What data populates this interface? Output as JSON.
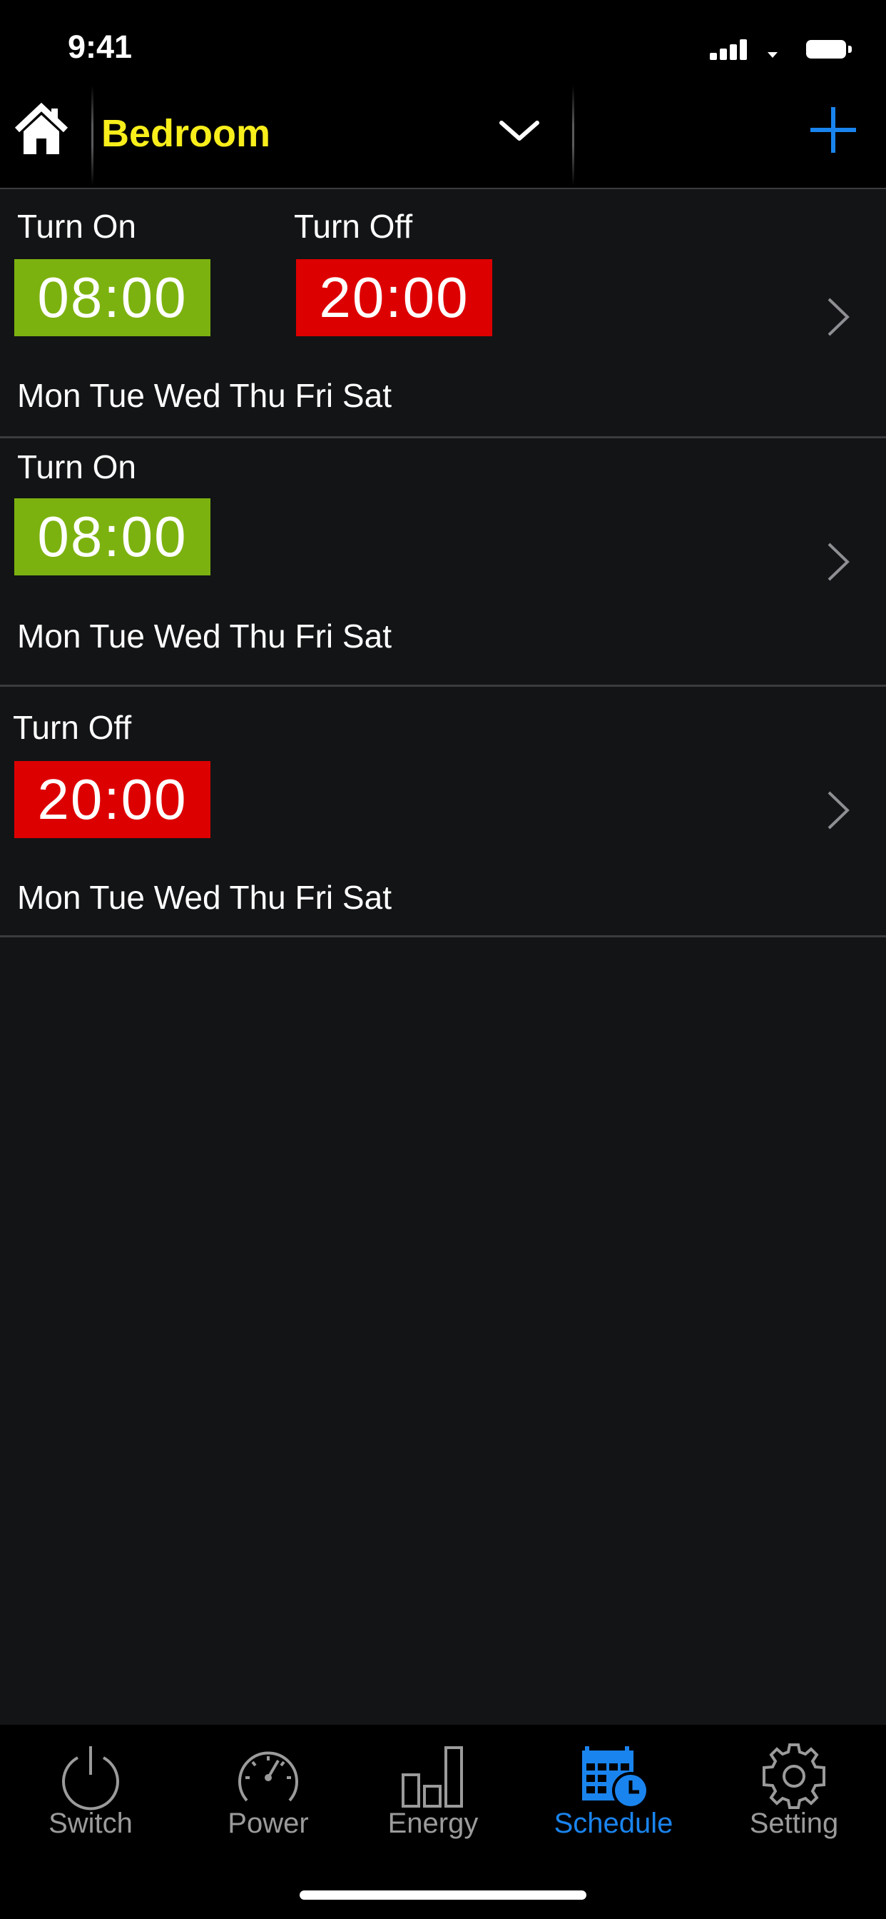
{
  "status_bar": {
    "time": "9:41",
    "icons": [
      "signal-icon",
      "wifi-icon",
      "battery-icon"
    ]
  },
  "header": {
    "room": "Bedroom",
    "icons": [
      "home-icon",
      "chevron-down-icon",
      "plus-icon"
    ],
    "title_color": "#f8ee1b",
    "accent_color": "#1a84ee"
  },
  "schedules": [
    {
      "on_label": "Turn On",
      "on_time": "08:00",
      "off_label": "Turn Off",
      "off_time": "20:00",
      "days": "Mon Tue Wed Thu Fri Sat"
    },
    {
      "on_label": "Turn On",
      "on_time": "08:00",
      "days": "Mon Tue Wed Thu Fri Sat"
    },
    {
      "off_label": "Turn Off",
      "off_time": "20:00",
      "days": "Mon Tue Wed Thu Fri Sat"
    }
  ],
  "colors": {
    "on": "#7cb20f",
    "off": "#dd0000",
    "background": "#131416"
  },
  "tabs": [
    {
      "label": "Switch",
      "icon": "power-icon",
      "active": false
    },
    {
      "label": "Power",
      "icon": "gauge-icon",
      "active": false
    },
    {
      "label": "Energy",
      "icon": "bar-chart-icon",
      "active": false
    },
    {
      "label": "Schedule",
      "icon": "calendar-clock-icon",
      "active": true
    },
    {
      "label": "Setting",
      "icon": "gear-icon",
      "active": false
    }
  ]
}
